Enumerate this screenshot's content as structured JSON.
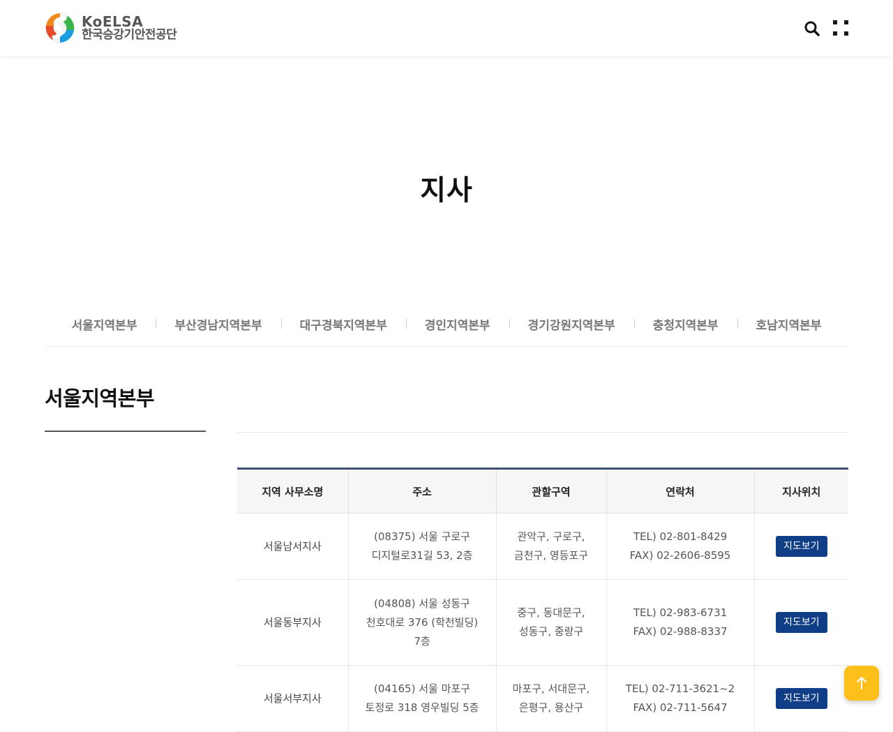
{
  "header": {
    "logo_en": "KoELSA",
    "logo_ko": "한국승강기안전공단",
    "search_icon": "search-icon",
    "menu_icon": "grid-menu-icon"
  },
  "page_title": "지사",
  "tabs": [
    {
      "label": "서울지역본부"
    },
    {
      "label": "부산경남지역본부"
    },
    {
      "label": "대구경북지역본부"
    },
    {
      "label": "경인지역본부"
    },
    {
      "label": "경기강원지역본부"
    },
    {
      "label": "충청지역본부"
    },
    {
      "label": "호남지역본부"
    }
  ],
  "section_title": "서울지역본부",
  "table": {
    "headers": [
      "지역 사무소명",
      "주소",
      "관할구역",
      "연락처",
      "지사위치"
    ],
    "rows": [
      {
        "office": "서울남서지사",
        "address": [
          "(08375) 서울 구로구",
          "디지털로31길 53, 2층"
        ],
        "district": [
          "관악구, 구로구,",
          "금천구, 영등포구"
        ],
        "contact": [
          "TEL) 02-801-8429",
          "FAX) 02-2606-8595"
        ],
        "map_label": "지도보기"
      },
      {
        "office": "서울동부지사",
        "address": [
          "(04808) 서울 성동구",
          "천호대로 376 (학천빌딩)",
          "7층"
        ],
        "district": [
          "중구, 동대문구,",
          "성동구, 중랑구"
        ],
        "contact": [
          "TEL) 02-983-6731",
          "FAX) 02-988-8337"
        ],
        "map_label": "지도보기"
      },
      {
        "office": "서울서부지사",
        "address": [
          "(04165) 서울 마포구",
          "토정로 318 영우빌딩 5층"
        ],
        "district": [
          "마포구, 서대문구,",
          "은평구, 용산구"
        ],
        "contact": [
          "TEL) 02-711-3621~2",
          "FAX) 02-711-5647"
        ],
        "map_label": "지도보기"
      }
    ]
  },
  "colors": {
    "accent_navy": "#103e86",
    "table_top_border": "#3a4f73",
    "top_button": "#fdbf1a"
  },
  "top_button_icon": "arrow-up-icon"
}
